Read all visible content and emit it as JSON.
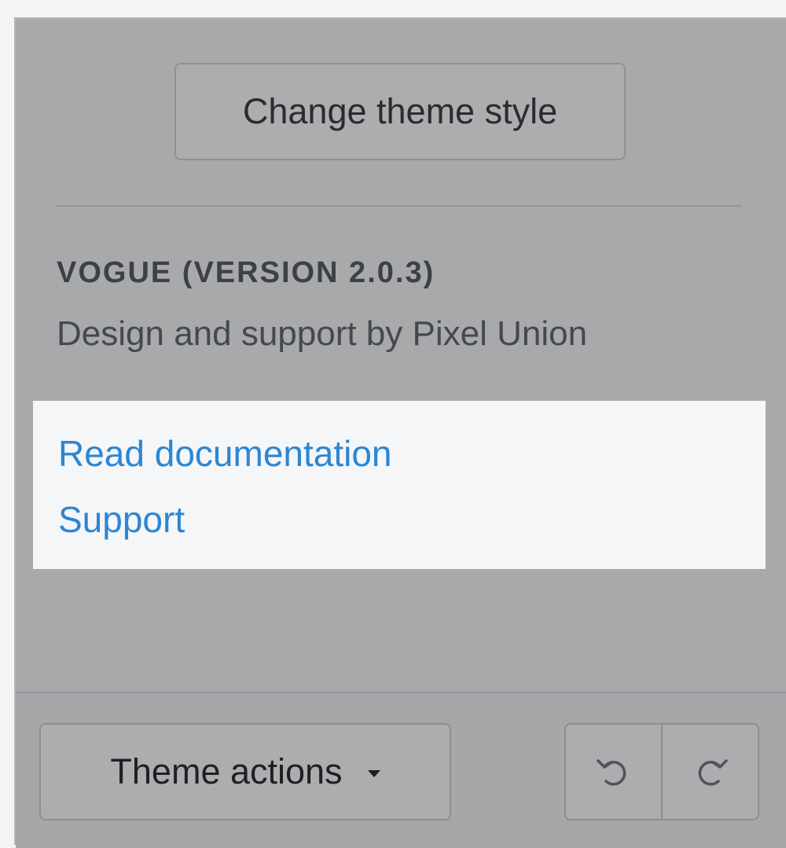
{
  "theme_panel": {
    "change_style_label": "Change theme style",
    "version_heading": "VOGUE (VERSION 2.0.3)",
    "credit_text": "Design and support by Pixel Union",
    "links": {
      "documentation": "Read documentation",
      "support": "Support"
    }
  },
  "footer": {
    "theme_actions_label": "Theme actions",
    "dropdown_icon": "caret-down-icon",
    "undo_icon": "undo-icon",
    "redo_icon": "redo-icon"
  },
  "colors": {
    "overlay_gray": "#a8a9aa",
    "link_blue": "#2c86d3",
    "highlight_bg": "#f4f6f8"
  }
}
